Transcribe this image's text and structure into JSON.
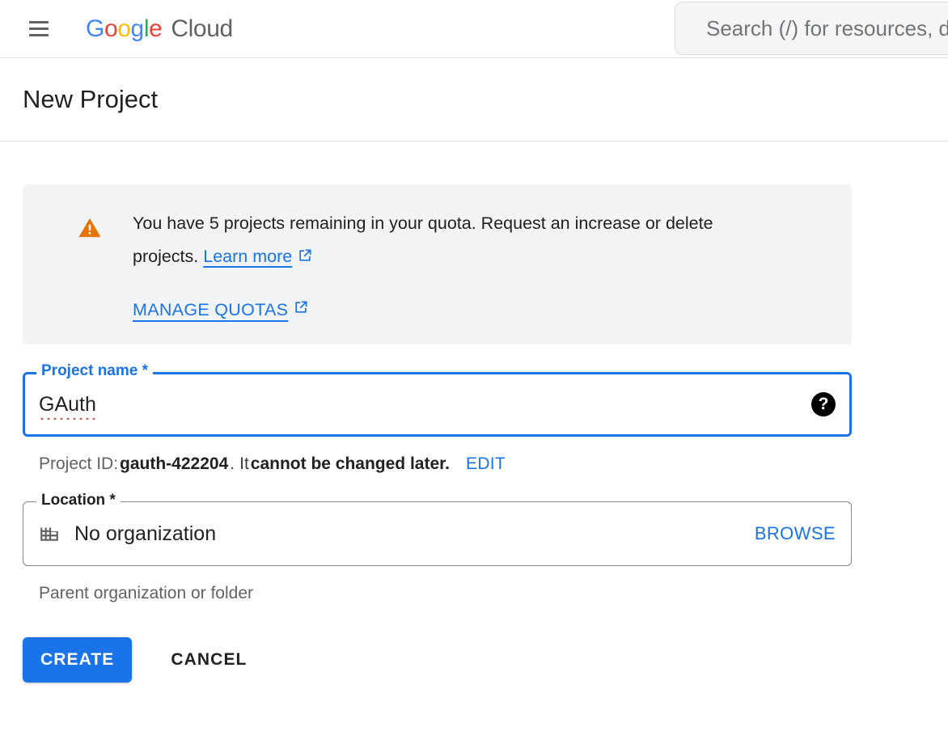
{
  "appbar": {
    "menu_label": "Main menu",
    "brand": {
      "google": [
        "G",
        "o",
        "o",
        "g",
        "l",
        "e"
      ],
      "cloud": "Cloud"
    },
    "search": {
      "placeholder": "Search (/) for resources, docs, products, and more",
      "value": ""
    }
  },
  "page": {
    "title": "New Project"
  },
  "banner": {
    "icon": "warning-triangle-icon",
    "icon_color": "#E37400",
    "text_before_link": "You have 5 projects remaining in your quota. Request an increase or delete projects. ",
    "learn_more_label": "Learn more",
    "manage_quotas_label": "MANAGE QUOTAS",
    "external_icon": "external-link-icon"
  },
  "project_name_field": {
    "label": "Project name *",
    "value": "GAuth",
    "help_icon": "help-question-icon",
    "focused": true
  },
  "project_id": {
    "prefix": "Project ID:",
    "id": "gauth-422204",
    "middle": ".",
    "it": "It",
    "emphasis": "cannot be changed later.",
    "edit_label": "EDIT"
  },
  "location_field": {
    "label": "Location *",
    "icon": "organization-building-icon",
    "value": "No organization",
    "browse_label": "BROWSE",
    "hint": "Parent organization or folder"
  },
  "actions": {
    "create_label": "CREATE",
    "cancel_label": "CANCEL"
  },
  "colors": {
    "accent_blue": "#1a73e8",
    "warning_orange": "#E37400",
    "banner_bg": "#f1f3f4",
    "text_primary": "#202124",
    "text_secondary": "#5f6368"
  }
}
